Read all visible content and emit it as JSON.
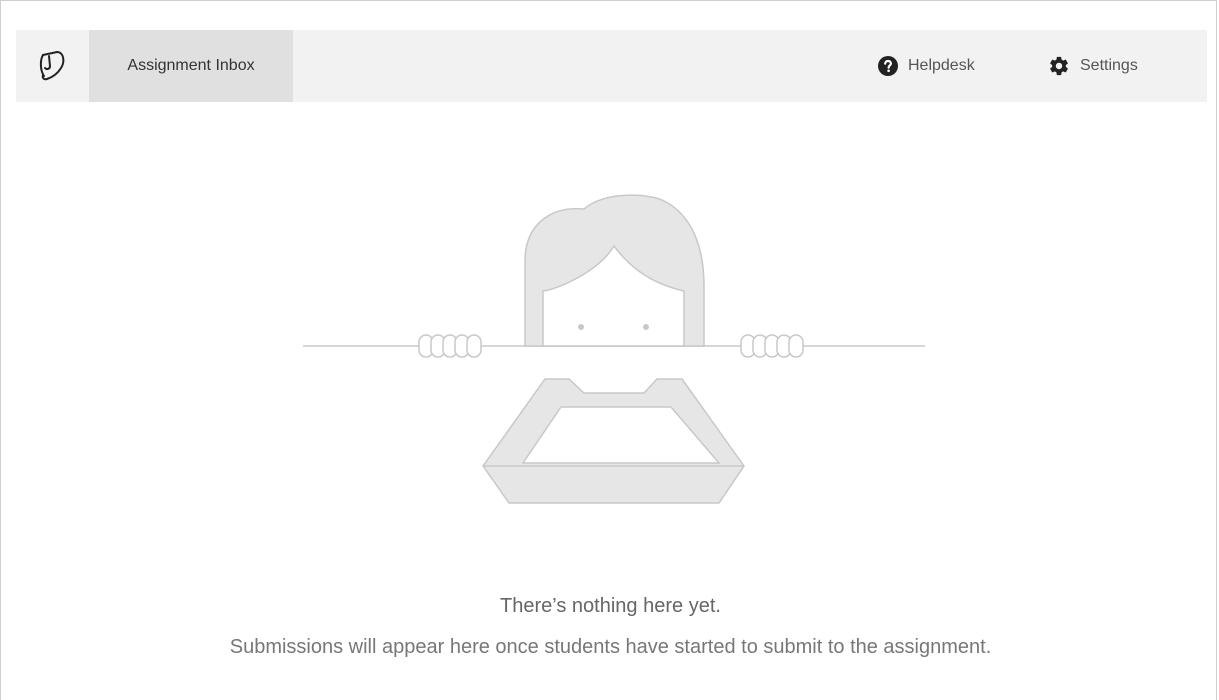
{
  "nav": {
    "logo_icon": "turnitin-logo-icon",
    "active_tab_label": "Assignment Inbox",
    "helpdesk_icon": "question-circle-icon",
    "helpdesk_label": "Helpdesk",
    "settings_icon": "gear-icon",
    "settings_label": "Settings"
  },
  "empty_state": {
    "illustration_icon": "peeking-person-empty-tray-illustration",
    "title": "There’s nothing here yet.",
    "description": "Submissions will appear here once students have started to submit to the assignment."
  },
  "colors": {
    "navbar_bg": "#f2f2f2",
    "active_tab_bg": "#e0e0e0",
    "illustration_fill": "#e6e6e6",
    "illustration_stroke": "#c8c8c8"
  }
}
